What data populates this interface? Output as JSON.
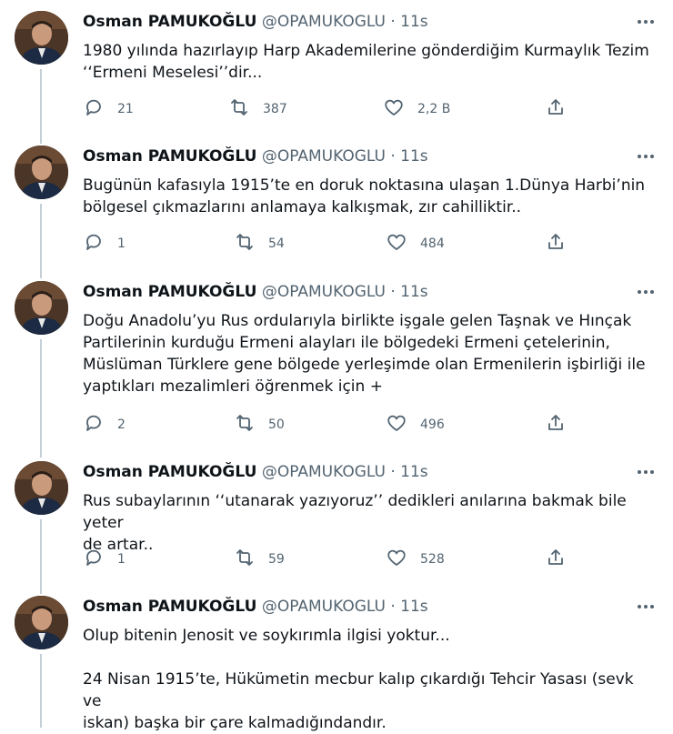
{
  "tweets": [
    {
      "name": "Osman PAMUKOĞLU",
      "handle": "@OPAMUKOGLU",
      "separator": "·",
      "time": "11s",
      "lines": [
        "1980 yılında hazırlayıp Harp Akademilerine gönderdiğim Kurmaylık Tezim",
        "‘‘Ermeni Meselesi’’dir..."
      ],
      "replies": "21",
      "retweets": "387",
      "likes": "2,2 B"
    },
    {
      "name": "Osman PAMUKOĞLU",
      "handle": "@OPAMUKOGLU",
      "separator": "·",
      "time": "11s",
      "lines": [
        "Bugünün kafasıyla 1915’te en doruk noktasına ulaşan 1.Dünya Harbi’nin",
        "bölgesel çıkmazlarını anlamaya kalkışmak, zır cahilliktir.."
      ],
      "replies": "1",
      "retweets": "54",
      "likes": "484"
    },
    {
      "name": "Osman PAMUKOĞLU",
      "handle": "@OPAMUKOGLU",
      "separator": "·",
      "time": "11s",
      "lines": [
        "Doğu Anadolu’yu Rus ordularıyla birlikte işgale gelen Taşnak ve Hınçak",
        "Partilerinin kurduğu Ermeni alayları ile bölgedeki Ermeni çetelerinin,",
        "Müslüman Türklere gene bölgede yerleşimde olan Ermenilerin işbirliği ile",
        "yaptıkları mezalimleri öğrenmek için +"
      ],
      "replies": "2",
      "retweets": "50",
      "likes": "496"
    },
    {
      "name": "Osman PAMUKOĞLU",
      "handle": "@OPAMUKOGLU",
      "separator": "·",
      "time": "11s",
      "lines": [
        "Rus subaylarının ‘‘utanarak yazıyoruz’’ dedikleri anılarına bakmak bile yeter",
        "de artar.."
      ],
      "replies": "1",
      "retweets": "59",
      "likes": "528"
    },
    {
      "name": "Osman PAMUKOĞLU",
      "handle": "@OPAMUKOGLU",
      "separator": "·",
      "time": "11s",
      "lines": [
        "Olup bitenin Jenosit ve soykırımla ilgisi yoktur..."
      ],
      "lines2": [
        "24 Nisan 1915’te, Hükümetin mecbur kalıp çıkardığı Tehcir Yasası (sevk ve",
        "iskan) başka bir çare kalmadığındandır."
      ]
    }
  ],
  "icons": {
    "reply": "reply-icon",
    "retweet": "retweet-icon",
    "like": "heart-icon",
    "share": "share-icon",
    "more": "more-icon"
  },
  "colors": {
    "text": "#0f1419",
    "secondary": "#536471",
    "thread_line": "#c4cfd6"
  }
}
